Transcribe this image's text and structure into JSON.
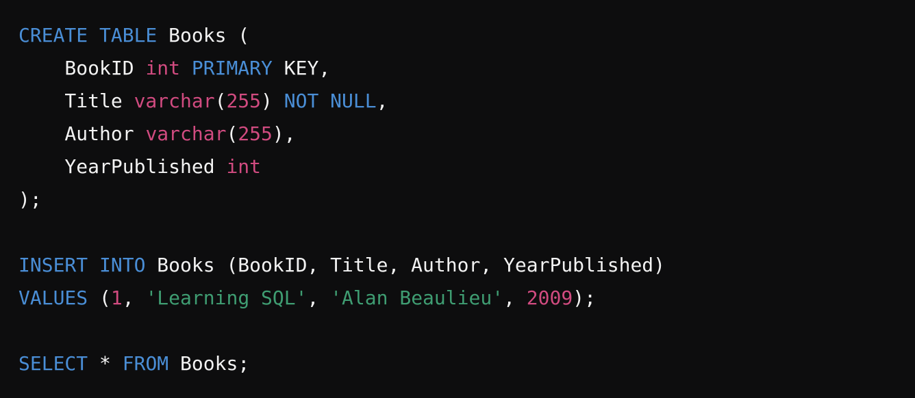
{
  "editor": {
    "language": "sql",
    "background_color": "#0d0d0e",
    "default_text_color": "#f2f2f2",
    "theme_colors": {
      "keyword": "#4a8ed6",
      "type": "#d14b80",
      "number": "#d14b80",
      "string": "#3f9d72",
      "plain": "#f2f2f2",
      "punctuation": "#f2f2f2"
    },
    "full_text": "CREATE TABLE Books (\n    BookID int PRIMARY KEY,\n    Title varchar(255) NOT NULL,\n    Author varchar(255),\n    YearPublished int\n);\n\nINSERT INTO Books (BookID, Title, Author, YearPublished)\nVALUES (1, 'Learning SQL', 'Alan Beaulieu', 2009);\n\nSELECT * FROM Books;",
    "lines": [
      {
        "text": "CREATE TABLE Books (",
        "tokens": [
          {
            "text": "CREATE TABLE",
            "kind": "keyword"
          },
          {
            "text": " Books (",
            "kind": "plain"
          }
        ]
      },
      {
        "text": "    BookID int PRIMARY KEY,",
        "tokens": [
          {
            "text": "    BookID ",
            "kind": "plain"
          },
          {
            "text": "int",
            "kind": "type"
          },
          {
            "text": " ",
            "kind": "plain"
          },
          {
            "text": "PRIMARY",
            "kind": "keyword"
          },
          {
            "text": " KEY,",
            "kind": "plain"
          }
        ]
      },
      {
        "text": "    Title varchar(255) NOT NULL,",
        "tokens": [
          {
            "text": "    Title ",
            "kind": "plain"
          },
          {
            "text": "varchar",
            "kind": "type"
          },
          {
            "text": "(",
            "kind": "punct"
          },
          {
            "text": "255",
            "kind": "number"
          },
          {
            "text": ") ",
            "kind": "punct"
          },
          {
            "text": "NOT NULL",
            "kind": "keyword"
          },
          {
            "text": ",",
            "kind": "punct"
          }
        ]
      },
      {
        "text": "    Author varchar(255),",
        "tokens": [
          {
            "text": "    Author ",
            "kind": "plain"
          },
          {
            "text": "varchar",
            "kind": "type"
          },
          {
            "text": "(",
            "kind": "punct"
          },
          {
            "text": "255",
            "kind": "number"
          },
          {
            "text": "),",
            "kind": "punct"
          }
        ]
      },
      {
        "text": "    YearPublished int",
        "tokens": [
          {
            "text": "    YearPublished ",
            "kind": "plain"
          },
          {
            "text": "int",
            "kind": "type"
          }
        ]
      },
      {
        "text": ");",
        "tokens": [
          {
            "text": ");",
            "kind": "punct"
          }
        ]
      },
      {
        "text": "",
        "tokens": []
      },
      {
        "text": "INSERT INTO Books (BookID, Title, Author, YearPublished)",
        "tokens": [
          {
            "text": "INSERT INTO",
            "kind": "keyword"
          },
          {
            "text": " Books (BookID, Title, Author, YearPublished)",
            "kind": "plain"
          }
        ]
      },
      {
        "text": "VALUES (1, 'Learning SQL', 'Alan Beaulieu', 2009);",
        "tokens": [
          {
            "text": "VALUES",
            "kind": "keyword"
          },
          {
            "text": " (",
            "kind": "punct"
          },
          {
            "text": "1",
            "kind": "number"
          },
          {
            "text": ", ",
            "kind": "punct"
          },
          {
            "text": "'Learning SQL'",
            "kind": "string"
          },
          {
            "text": ", ",
            "kind": "punct"
          },
          {
            "text": "'Alan Beaulieu'",
            "kind": "string"
          },
          {
            "text": ", ",
            "kind": "punct"
          },
          {
            "text": "2009",
            "kind": "number"
          },
          {
            "text": ");",
            "kind": "punct"
          }
        ]
      },
      {
        "text": "",
        "tokens": []
      },
      {
        "text": "SELECT * FROM Books;",
        "tokens": [
          {
            "text": "SELECT",
            "kind": "keyword"
          },
          {
            "text": " * ",
            "kind": "plain"
          },
          {
            "text": "FROM",
            "kind": "keyword"
          },
          {
            "text": " Books;",
            "kind": "plain"
          }
        ]
      }
    ]
  }
}
